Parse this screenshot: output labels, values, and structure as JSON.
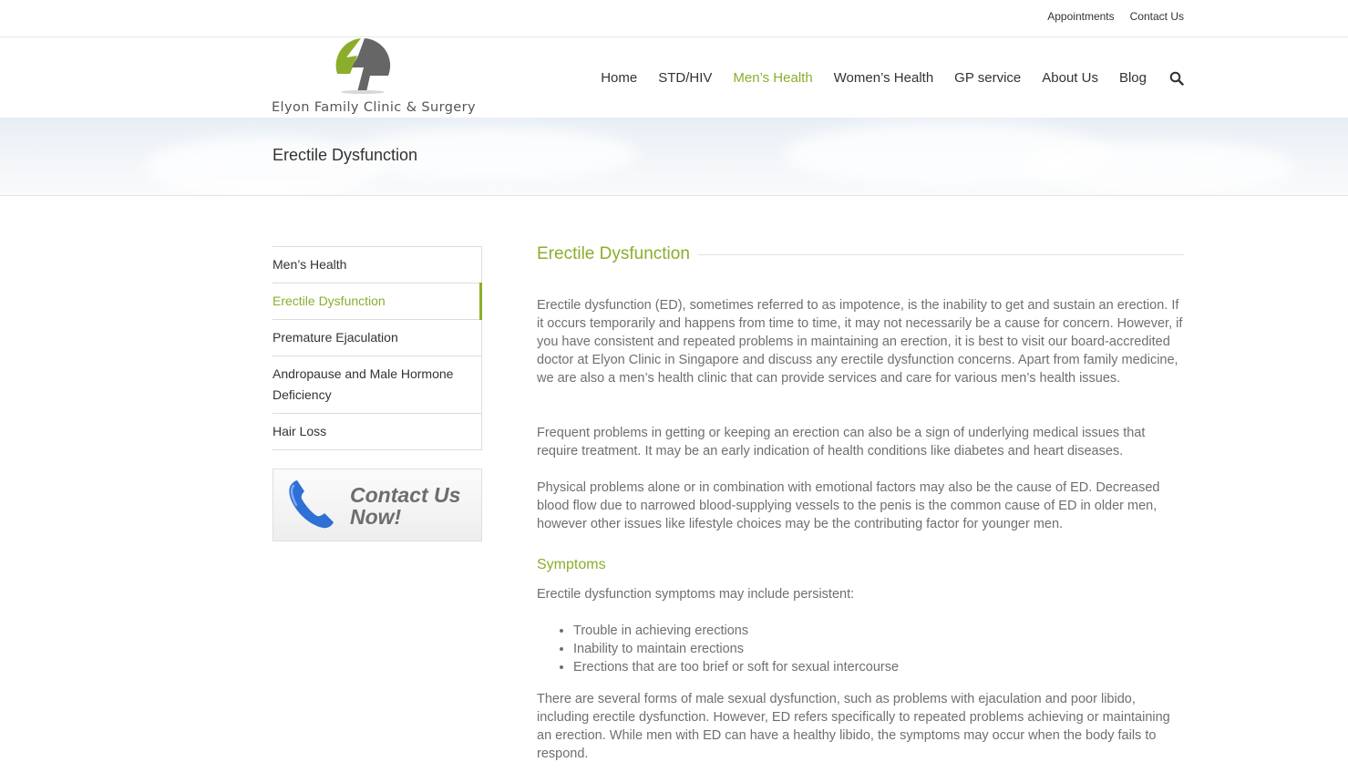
{
  "topbar": {
    "links": [
      "Appointments",
      "Contact Us"
    ]
  },
  "header": {
    "logo_text": "Elyon Family Clinic & Surgery",
    "nav": [
      "Home",
      "STD/HIV",
      "Men’s Health",
      "Women’s Health",
      "GP service",
      "About Us",
      "Blog"
    ],
    "active_nav": "Men’s Health",
    "search_icon": "search-icon"
  },
  "page_title": "Erectile Dysfunction",
  "sidebar": {
    "items": [
      "Men’s Health",
      "Erectile Dysfunction",
      "Premature Ejaculation",
      "Andropause and Male Hormone Deficiency",
      "Hair Loss"
    ],
    "active_item": "Erectile Dysfunction",
    "contact_banner_line1": "Contact Us",
    "contact_banner_line2": "Now!"
  },
  "content": {
    "heading": "Erectile Dysfunction",
    "paragraph1": "Erectile dysfunction (ED), sometimes referred to as impotence, is the inability to get and sustain an erection. If it occurs temporarily and happens from time to time, it may not necessarily be a cause for concern. However, if you have consistent and repeated problems in maintaining an erection, it is best to visit our board-accredited doctor at Elyon Clinic in Singapore and discuss any erectile dysfunction concerns. Apart from family medicine, we are also a men’s health clinic that can provide services and care for various men’s health issues.",
    "paragraph2": "Frequent problems in getting or keeping an erection can also be a sign of underlying medical issues that require treatment. It may be an early indication of health conditions like diabetes and heart diseases.",
    "paragraph3": "Physical problems alone or in combination with emotional factors may also be the cause of ED. Decreased blood flow due to narrowed blood-supplying vessels to the penis is the common cause of ED in older men, however other issues like lifestyle choices may be the contributing factor for younger men.",
    "symptoms_heading": "Symptoms",
    "symptoms_intro": "Erectile dysfunction symptoms may include persistent:",
    "symptoms": [
      "Trouble in achieving erections",
      "Inability to maintain erections",
      "Erections that are too brief or soft for sexual intercourse"
    ],
    "paragraph5": "There are several forms of male sexual dysfunction, such as problems with ejaculation and poor libido, including erectile dysfunction. However, ED refers specifically to repeated problems achieving or maintaining an erection. While men with ED can have a healthy libido, the symptoms may occur when the body fails to respond."
  },
  "colors": {
    "accent": "#8cad2c",
    "body_text": "#6f6f6f",
    "logo_gray": "#666666"
  }
}
